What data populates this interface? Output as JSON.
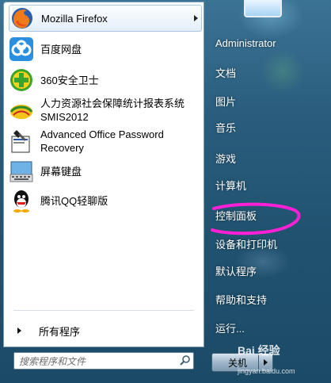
{
  "start_menu": {
    "programs": [
      {
        "label": "Mozilla Firefox",
        "icon": "firefox-icon",
        "has_submenu": true
      },
      {
        "label": "百度网盘",
        "icon": "baidu-netdisk-icon"
      },
      {
        "label": "360安全卫士",
        "icon": "360-security-icon"
      },
      {
        "label_line1": "人力资源社会保障统计报表系统",
        "label_line2": "SMIS2012",
        "icon": "smis-icon"
      },
      {
        "label_line1": "Advanced Office Password",
        "label_line2": "Recovery",
        "icon": "password-recovery-icon"
      },
      {
        "label": "屏幕键盘",
        "icon": "keyboard-icon"
      },
      {
        "label": "腾讯QQ轻聊版",
        "icon": "qq-icon"
      }
    ],
    "all_programs": "所有程序",
    "search_placeholder": "搜索程序和文件",
    "right_links": [
      "Administrator",
      "文档",
      "图片",
      "音乐",
      "游戏",
      "计算机",
      "控制面板",
      "设备和打印机",
      "默认程序",
      "帮助和支持",
      "运行..."
    ],
    "shutdown_label": "关机",
    "watermark_brand": "Bai 经验",
    "watermark_url": "jingyan.baidu.com",
    "annotation_color": "#ff1fd6"
  }
}
